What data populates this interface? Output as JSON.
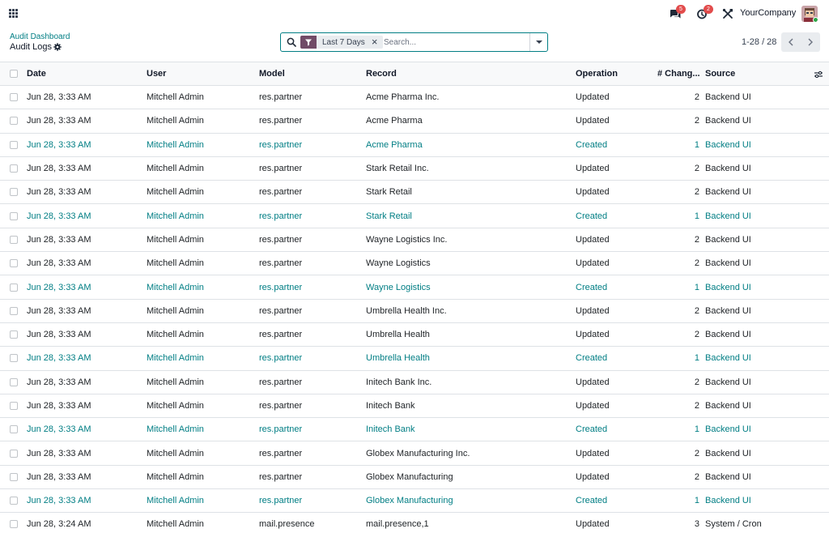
{
  "navbar": {
    "messages_badge": "5",
    "activities_badge": "2",
    "company": "YourCompany"
  },
  "control_panel": {
    "breadcrumb": "Audit Dashboard",
    "title": "Audit Logs",
    "facet": "Last 7 Days",
    "search_placeholder": "Search...",
    "pager": "1-28 / 28"
  },
  "table": {
    "columns": [
      "Date",
      "User",
      "Model",
      "Record",
      "Operation",
      "# Chang...",
      "Source"
    ],
    "rows": [
      {
        "date": "Jun 28, 3:33 AM",
        "user": "Mitchell Admin",
        "model": "res.partner",
        "record": "Acme Pharma Inc.",
        "operation": "Updated",
        "changes": "2",
        "source": "Backend UI"
      },
      {
        "date": "Jun 28, 3:33 AM",
        "user": "Mitchell Admin",
        "model": "res.partner",
        "record": "Acme Pharma",
        "operation": "Updated",
        "changes": "2",
        "source": "Backend UI"
      },
      {
        "date": "Jun 28, 3:33 AM",
        "user": "Mitchell Admin",
        "model": "res.partner",
        "record": "Acme Pharma",
        "operation": "Created",
        "changes": "1",
        "source": "Backend UI"
      },
      {
        "date": "Jun 28, 3:33 AM",
        "user": "Mitchell Admin",
        "model": "res.partner",
        "record": "Stark Retail Inc.",
        "operation": "Updated",
        "changes": "2",
        "source": "Backend UI"
      },
      {
        "date": "Jun 28, 3:33 AM",
        "user": "Mitchell Admin",
        "model": "res.partner",
        "record": "Stark Retail",
        "operation": "Updated",
        "changes": "2",
        "source": "Backend UI"
      },
      {
        "date": "Jun 28, 3:33 AM",
        "user": "Mitchell Admin",
        "model": "res.partner",
        "record": "Stark Retail",
        "operation": "Created",
        "changes": "1",
        "source": "Backend UI"
      },
      {
        "date": "Jun 28, 3:33 AM",
        "user": "Mitchell Admin",
        "model": "res.partner",
        "record": "Wayne Logistics Inc.",
        "operation": "Updated",
        "changes": "2",
        "source": "Backend UI"
      },
      {
        "date": "Jun 28, 3:33 AM",
        "user": "Mitchell Admin",
        "model": "res.partner",
        "record": "Wayne Logistics",
        "operation": "Updated",
        "changes": "2",
        "source": "Backend UI"
      },
      {
        "date": "Jun 28, 3:33 AM",
        "user": "Mitchell Admin",
        "model": "res.partner",
        "record": "Wayne Logistics",
        "operation": "Created",
        "changes": "1",
        "source": "Backend UI"
      },
      {
        "date": "Jun 28, 3:33 AM",
        "user": "Mitchell Admin",
        "model": "res.partner",
        "record": "Umbrella Health Inc.",
        "operation": "Updated",
        "changes": "2",
        "source": "Backend UI"
      },
      {
        "date": "Jun 28, 3:33 AM",
        "user": "Mitchell Admin",
        "model": "res.partner",
        "record": "Umbrella Health",
        "operation": "Updated",
        "changes": "2",
        "source": "Backend UI"
      },
      {
        "date": "Jun 28, 3:33 AM",
        "user": "Mitchell Admin",
        "model": "res.partner",
        "record": "Umbrella Health",
        "operation": "Created",
        "changes": "1",
        "source": "Backend UI"
      },
      {
        "date": "Jun 28, 3:33 AM",
        "user": "Mitchell Admin",
        "model": "res.partner",
        "record": "Initech Bank Inc.",
        "operation": "Updated",
        "changes": "2",
        "source": "Backend UI"
      },
      {
        "date": "Jun 28, 3:33 AM",
        "user": "Mitchell Admin",
        "model": "res.partner",
        "record": "Initech Bank",
        "operation": "Updated",
        "changes": "2",
        "source": "Backend UI"
      },
      {
        "date": "Jun 28, 3:33 AM",
        "user": "Mitchell Admin",
        "model": "res.partner",
        "record": "Initech Bank",
        "operation": "Created",
        "changes": "1",
        "source": "Backend UI"
      },
      {
        "date": "Jun 28, 3:33 AM",
        "user": "Mitchell Admin",
        "model": "res.partner",
        "record": "Globex Manufacturing Inc.",
        "operation": "Updated",
        "changes": "2",
        "source": "Backend UI"
      },
      {
        "date": "Jun 28, 3:33 AM",
        "user": "Mitchell Admin",
        "model": "res.partner",
        "record": "Globex Manufacturing",
        "operation": "Updated",
        "changes": "2",
        "source": "Backend UI"
      },
      {
        "date": "Jun 28, 3:33 AM",
        "user": "Mitchell Admin",
        "model": "res.partner",
        "record": "Globex Manufacturing",
        "operation": "Created",
        "changes": "1",
        "source": "Backend UI"
      },
      {
        "date": "Jun 28, 3:24 AM",
        "user": "Mitchell Admin",
        "model": "mail.presence",
        "record": "mail.presence,1",
        "operation": "Updated",
        "changes": "3",
        "source": "System / Cron"
      }
    ]
  },
  "colors": {
    "accent": "#017e84",
    "brand": "#714b67",
    "badge": "#e24c4c"
  },
  "icons": [
    "apps-icon",
    "messages-icon",
    "activities-icon",
    "debug-icon",
    "settings-gear-icon",
    "search-icon",
    "filter-icon",
    "close-icon",
    "chevron-down-icon",
    "chevron-left-icon",
    "chevron-right-icon",
    "optional-columns-icon"
  ]
}
